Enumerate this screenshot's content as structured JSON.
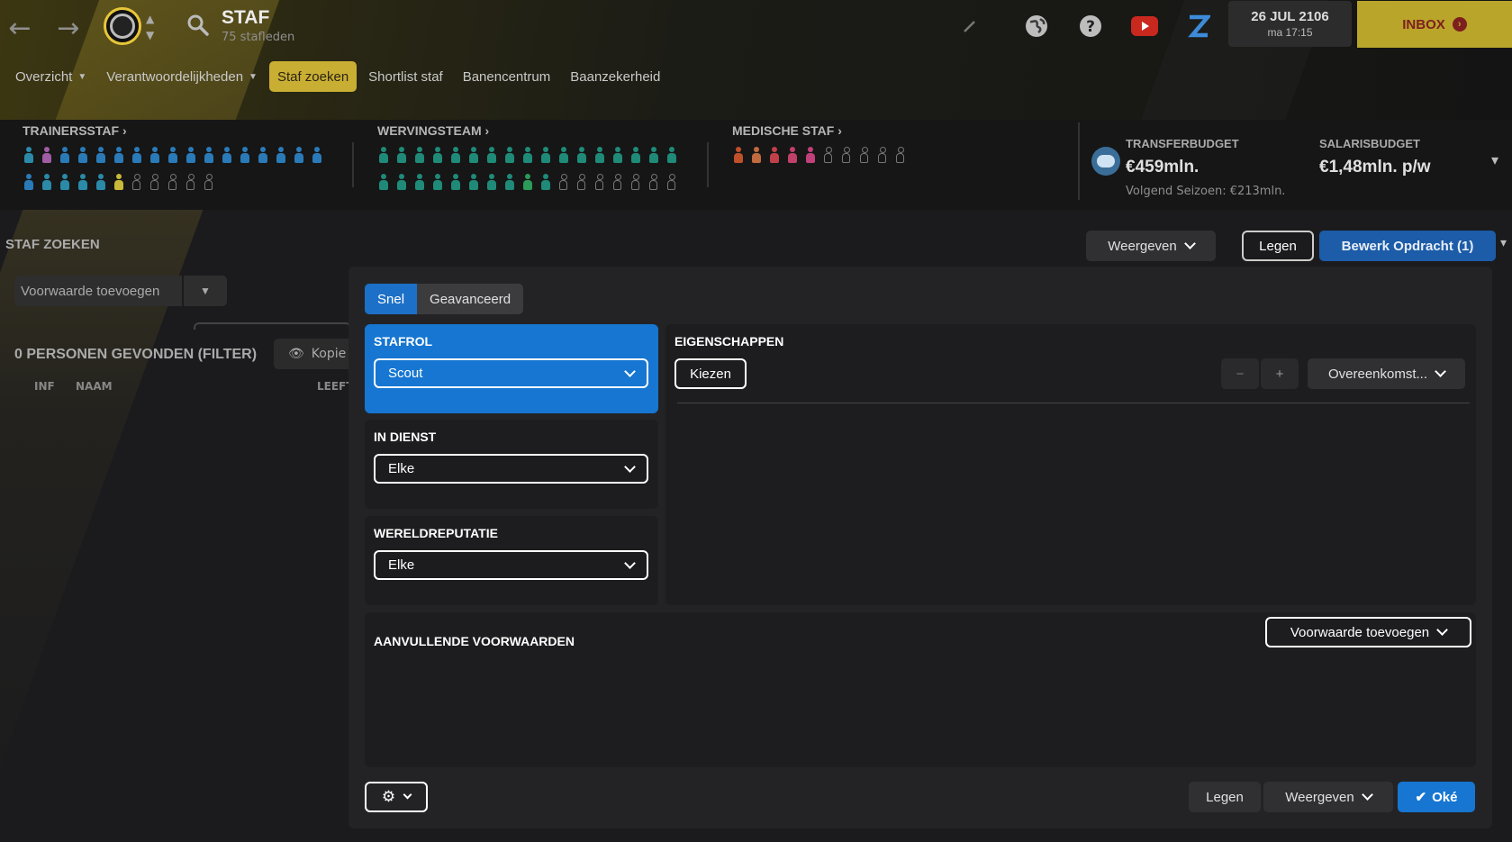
{
  "header": {
    "title": "STAF",
    "subtitle": "75 stafleden",
    "date": "26 JUL 2106",
    "time": "ma 17:15",
    "inbox_label": "INBOX"
  },
  "tabs": [
    {
      "label": "Overzicht",
      "dropdown": true
    },
    {
      "label": "Verantwoordelijkheden",
      "dropdown": true
    },
    {
      "label": "Staf zoeken",
      "active": true
    },
    {
      "label": "Shortlist staf"
    },
    {
      "label": "Banencentrum"
    },
    {
      "label": "Baanzekerheid"
    }
  ],
  "staff_groups": {
    "trainers": {
      "label": "TRAINERSSTAF",
      "icons": [
        "#2a8aa8",
        "#a05da3",
        "#2a7ab8",
        "#2a7ab8",
        "#2a7ab8",
        "#2a7ab8",
        "#2a7ab8",
        "#2a7ab8",
        "#2a7ab8",
        "#2a7ab8",
        "#2a7ab8",
        "#2a7ab8",
        "#2a7ab8",
        "#2a7ab8",
        "#2a7ab8",
        "#2a7ab8",
        "#2a7ab8",
        "#2a7ab8",
        "#2a8aa8",
        "#2a8aa8",
        "#2a8aa8",
        "#2a8aa8",
        "#c9b93a",
        "empty",
        "empty",
        "empty",
        "empty",
        "empty"
      ]
    },
    "recruit": {
      "label": "WERVINGSTEAM",
      "icons": [
        "#1f8a78",
        "#1f8a78",
        "#1f8a78",
        "#1f8a78",
        "#1f8a78",
        "#1f8a78",
        "#1f8a78",
        "#1f8a78",
        "#1f8a78",
        "#1f8a78",
        "#1f8a78",
        "#1f8a78",
        "#1f8a78",
        "#1f8a78",
        "#1f8a78",
        "#1f8a78",
        "#1f8a78",
        "#1f8a78",
        "#1f8a78",
        "#1f8a78",
        "#1f8a78",
        "#1f8a78",
        "#1f8a78",
        "#1f8a78",
        "#1f8a78",
        "#2c9a58",
        "#1f8a78",
        "empty",
        "empty",
        "empty",
        "empty",
        "empty",
        "empty",
        "empty"
      ]
    },
    "medical": {
      "label": "MEDISCHE STAF",
      "icons": [
        "#c0502a",
        "#c06a40",
        "#c0404a",
        "#c0406a",
        "#c0407a",
        "empty",
        "empty",
        "empty",
        "empty",
        "empty"
      ]
    }
  },
  "budgets": {
    "transfer": {
      "label": "TRANSFERBUDGET",
      "value": "€459mln.",
      "note": "Volgend Seizoen: €213mln."
    },
    "salary": {
      "label": "SALARISBUDGET",
      "value": "€1,48mln. p/w"
    }
  },
  "left_panel": {
    "heading": "STAF ZOEKEN",
    "add_condition": "Voorwaarde toevoegen",
    "found": "0 PERSONEN GEVONDEN (FILTER)",
    "copy_label": "Kopie",
    "columns": [
      "INF",
      "NAAM",
      "LEEFT"
    ]
  },
  "top_actions": {
    "show": "Weergeven",
    "clear": "Legen",
    "edit": "Bewerk Opdracht (1)"
  },
  "modal": {
    "tabs": [
      {
        "label": "Snel",
        "active": true
      },
      {
        "label": "Geavanceerd"
      }
    ],
    "stafrol": {
      "label": "STAFROL",
      "value": "Scout"
    },
    "in_dienst": {
      "label": "IN DIENST",
      "value": "Elke"
    },
    "wereldreputatie": {
      "label": "WERELDREPUTATIE",
      "value": "Elke"
    },
    "eigenschappen": {
      "label": "EIGENSCHAPPEN",
      "choose": "Kiezen",
      "minus": "−",
      "plus": "+",
      "agreement": "Overeenkomst..."
    },
    "extra": {
      "label": "AANVULLENDE VOORWAARDEN",
      "add": "Voorwaarde toevoegen"
    },
    "footer": {
      "clear": "Legen",
      "show": "Weergeven",
      "ok": "Oké"
    }
  }
}
